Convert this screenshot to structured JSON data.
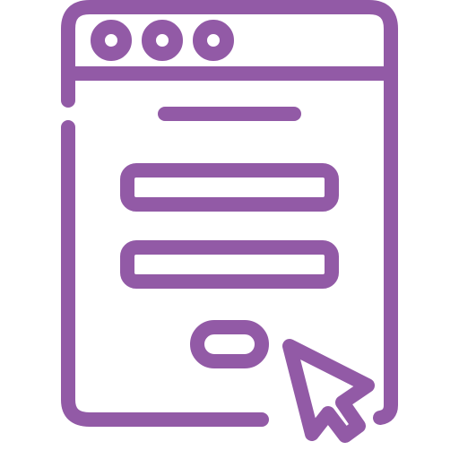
{
  "icon": {
    "name": "login-form-cursor-icon",
    "stroke_color": "#925aa6",
    "background": "#ffffff"
  },
  "window": {
    "dots": [
      "dot-1",
      "dot-2",
      "dot-3"
    ]
  },
  "form": {
    "fields": [
      "field-1",
      "field-2"
    ]
  }
}
